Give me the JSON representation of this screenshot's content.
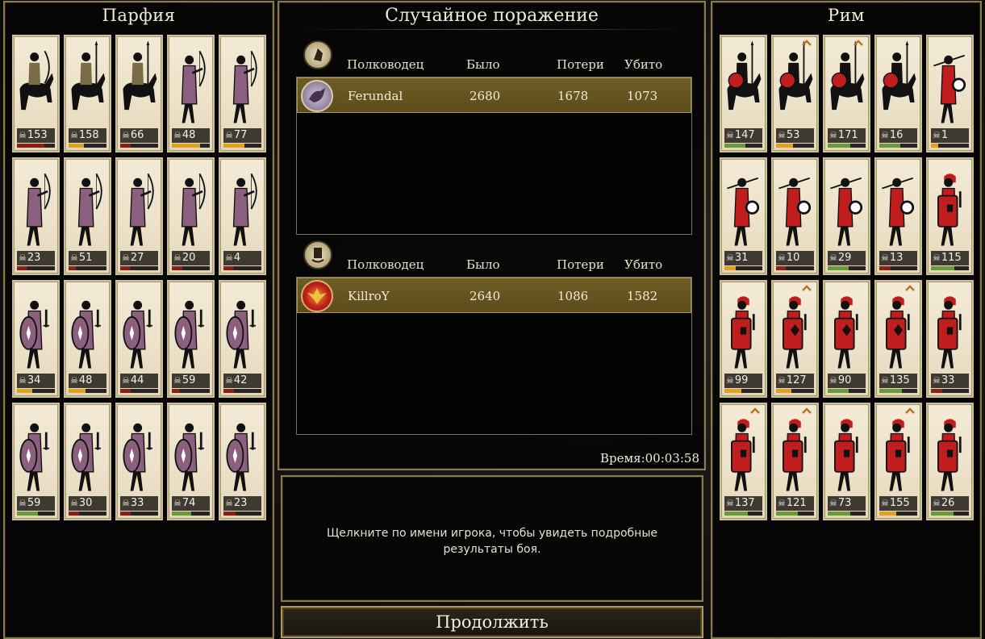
{
  "left_army": {
    "title": "Парфия",
    "units": [
      {
        "type": "horse-archer",
        "count": "153",
        "health": 0.72,
        "health_color": "#8a2018"
      },
      {
        "type": "cataphract",
        "count": "158",
        "health": 0.4,
        "health_color": "#e0a020"
      },
      {
        "type": "cataphract",
        "count": "66",
        "health": 0.28,
        "health_color": "#8a2018"
      },
      {
        "type": "archer",
        "count": "48",
        "health": 0.75,
        "health_color": "#e0a020"
      },
      {
        "type": "archer",
        "count": "77",
        "health": 0.55,
        "health_color": "#e0a020"
      },
      {
        "type": "archer",
        "count": "23",
        "health": 0.25,
        "health_color": "#8a2018"
      },
      {
        "type": "archer",
        "count": "51",
        "health": 0.2,
        "health_color": "#8a2018"
      },
      {
        "type": "archer",
        "count": "27",
        "health": 0.25,
        "health_color": "#8a2018"
      },
      {
        "type": "archer",
        "count": "20",
        "health": 0.28,
        "health_color": "#8a2018"
      },
      {
        "type": "archer",
        "count": "4",
        "health": 0.25,
        "health_color": "#8a2018"
      },
      {
        "type": "swordsman",
        "count": "34",
        "health": 0.4,
        "health_color": "#e0a020"
      },
      {
        "type": "swordsman",
        "count": "48",
        "health": 0.45,
        "health_color": "#e0a020"
      },
      {
        "type": "swordsman",
        "count": "44",
        "health": 0.28,
        "health_color": "#8a2018"
      },
      {
        "type": "swordsman",
        "count": "59",
        "health": 0.22,
        "health_color": "#8a2018"
      },
      {
        "type": "swordsman",
        "count": "42",
        "health": 0.28,
        "health_color": "#8a2018"
      },
      {
        "type": "swordsman",
        "count": "59",
        "health": 0.55,
        "health_color": "#6a9a3a"
      },
      {
        "type": "swordsman",
        "count": "30",
        "health": 0.28,
        "health_color": "#8a2018"
      },
      {
        "type": "swordsman",
        "count": "33",
        "health": 0.28,
        "health_color": "#8a2018"
      },
      {
        "type": "swordsman",
        "count": "74",
        "health": 0.52,
        "health_color": "#6a9a3a"
      },
      {
        "type": "swordsman",
        "count": "23",
        "health": 0.32,
        "health_color": "#8a2018"
      }
    ]
  },
  "right_army": {
    "title": "Рим",
    "units": [
      {
        "type": "general-cavalry",
        "count": "147",
        "health": 0.55,
        "health_color": "#6a9a3a",
        "chevron": false
      },
      {
        "type": "cavalry",
        "count": "53",
        "health": 0.45,
        "health_color": "#e0a020",
        "chevron": true
      },
      {
        "type": "cavalry",
        "count": "171",
        "health": 0.6,
        "health_color": "#6a9a3a",
        "chevron": true
      },
      {
        "type": "cavalry",
        "count": "16",
        "health": 0.55,
        "health_color": "#6a9a3a",
        "chevron": false
      },
      {
        "type": "skirmisher",
        "count": "1",
        "health": 0.2,
        "health_color": "#e0a020",
        "chevron": false
      },
      {
        "type": "skirmisher",
        "count": "31",
        "health": 0.3,
        "health_color": "#e0a020",
        "chevron": false
      },
      {
        "type": "skirmisher",
        "count": "10",
        "health": 0.25,
        "health_color": "#8a2018",
        "chevron": false
      },
      {
        "type": "skirmisher",
        "count": "29",
        "health": 0.55,
        "health_color": "#6a9a3a",
        "chevron": false
      },
      {
        "type": "skirmisher",
        "count": "13",
        "health": 0.3,
        "health_color": "#8a2018",
        "chevron": false
      },
      {
        "type": "legionary-rect",
        "count": "115",
        "health": 0.62,
        "health_color": "#6a9a3a",
        "chevron": false
      },
      {
        "type": "legionary",
        "count": "99",
        "health": 0.45,
        "health_color": "#e0a020",
        "chevron": false
      },
      {
        "type": "legionary-eagle",
        "count": "127",
        "health": 0.4,
        "health_color": "#e0a020",
        "chevron": true
      },
      {
        "type": "legionary-eagle",
        "count": "90",
        "health": 0.55,
        "health_color": "#6a9a3a",
        "chevron": false
      },
      {
        "type": "legionary-eagle",
        "count": "135",
        "health": 0.6,
        "health_color": "#6a9a3a",
        "chevron": true
      },
      {
        "type": "legionary",
        "count": "33",
        "health": 0.3,
        "health_color": "#8a2018",
        "chevron": false
      },
      {
        "type": "legionary",
        "count": "137",
        "health": 0.62,
        "health_color": "#6a9a3a",
        "chevron": true
      },
      {
        "type": "legionary",
        "count": "121",
        "health": 0.58,
        "health_color": "#6a9a3a",
        "chevron": true
      },
      {
        "type": "legionary",
        "count": "73",
        "health": 0.6,
        "health_color": "#6a9a3a",
        "chevron": false
      },
      {
        "type": "legionary",
        "count": "155",
        "health": 0.45,
        "health_color": "#e0a020",
        "chevron": true
      },
      {
        "type": "legionary",
        "count": "26",
        "health": 0.6,
        "health_color": "#6a9a3a",
        "chevron": false
      }
    ]
  },
  "result": {
    "title": "Случайное поражение",
    "columns": [
      "Полководец",
      "Было",
      "Потери",
      "Убито"
    ],
    "players": [
      {
        "name": "Ferundal",
        "was": "2680",
        "losses": "1678",
        "killed": "1073",
        "emblem": "parthian-emblem",
        "avatar": "griffin-avatar"
      },
      {
        "name": "KillroY",
        "was": "2640",
        "losses": "1086",
        "killed": "1582",
        "emblem": "roman-emblem",
        "avatar": "eagle-avatar"
      }
    ],
    "time_label": "Время:00:03:58"
  },
  "info": {
    "text": "Щелкните по имени игрока, чтобы увидеть подробные результаты боя."
  },
  "continue_button": "Продолжить",
  "colors": {
    "parthian_unit": "#8c5f7e",
    "roman_unit": "#c01e1e",
    "frame_gold": "#8a7a52",
    "row_gold": "#6d5c24"
  }
}
